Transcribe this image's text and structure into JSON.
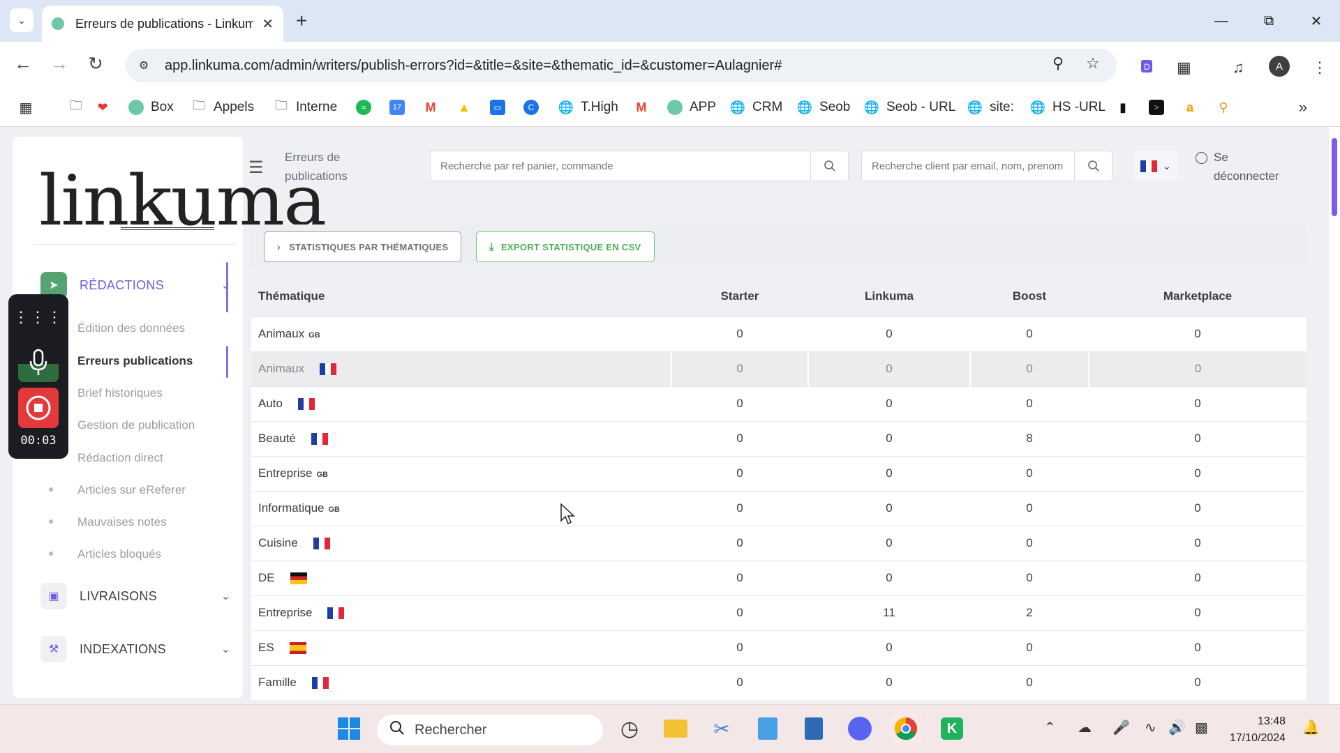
{
  "browser": {
    "tab_title": "Erreurs de publications - Linkuma",
    "url": "app.linkuma.com/admin/writers/publish-errors?id=&title=&site=&thematic_id=&customer=Aulagnier#",
    "profile_initial": "A",
    "bookmarks": [
      {
        "label": "Box",
        "icon": "linkuma-favicon"
      },
      {
        "label": "Appels",
        "icon": "folder-icon"
      },
      {
        "label": "Interne",
        "icon": "folder-icon"
      },
      {
        "label": "T.High",
        "icon": "globe-icon"
      },
      {
        "label": "APP",
        "icon": "linkuma-favicon"
      },
      {
        "label": "CRM",
        "icon": "globe-icon"
      },
      {
        "label": "Seob",
        "icon": "globe-icon"
      },
      {
        "label": "Seob - URL",
        "icon": "globe-icon"
      },
      {
        "label": "site:",
        "icon": "globe-icon"
      },
      {
        "label": "HS -URL",
        "icon": "globe-icon"
      }
    ]
  },
  "sidebar": {
    "logo_text": "linkuma",
    "sections": [
      {
        "label": "RÉDACTIONS",
        "color": "#57a272"
      },
      {
        "label": "LIVRAISONS"
      },
      {
        "label": "INDEXATIONS"
      }
    ],
    "links": [
      "Édition des données",
      "Erreurs publications",
      "Brief historiques",
      "Gestion de publication",
      "Rédaction direct",
      "Articles sur eReferer",
      "Mauvaises notes",
      "Articles bloqués"
    ]
  },
  "recorder": {
    "time": "00:03"
  },
  "header": {
    "title": "Erreurs de publications",
    "search_order_placeholder": "Recherche par ref panier, commande",
    "search_client_placeholder": "Recherche client par email, nom, prenom",
    "logout_label": "Se déconnecter"
  },
  "actions": {
    "stats_label": "STATISTIQUES PAR THÉMATIQUES",
    "export_label": "EXPORT STATISTIQUE EN CSV"
  },
  "table": {
    "columns": [
      "Thématique",
      "Starter",
      "Linkuma",
      "Boost",
      "Marketplace"
    ],
    "rows": [
      {
        "name": "Animaux",
        "lang": "GB",
        "values": [
          "0",
          "0",
          "0",
          "0"
        ]
      },
      {
        "name": "Animaux",
        "lang": "FR",
        "values": [
          "0",
          "0",
          "0",
          "0"
        ]
      },
      {
        "name": "Auto",
        "lang": "FR",
        "values": [
          "0",
          "0",
          "0",
          "0"
        ]
      },
      {
        "name": "Beauté",
        "lang": "FR",
        "values": [
          "0",
          "0",
          "8",
          "0"
        ]
      },
      {
        "name": "Entreprise",
        "lang": "GB",
        "values": [
          "0",
          "0",
          "0",
          "0"
        ]
      },
      {
        "name": "Informatique",
        "lang": "GB",
        "values": [
          "0",
          "0",
          "0",
          "0"
        ]
      },
      {
        "name": "Cuisine",
        "lang": "FR",
        "values": [
          "0",
          "0",
          "0",
          "0"
        ]
      },
      {
        "name": "DE",
        "lang": "DE",
        "values": [
          "0",
          "0",
          "0",
          "0"
        ]
      },
      {
        "name": "Entreprise",
        "lang": "FR",
        "values": [
          "0",
          "11",
          "2",
          "0"
        ]
      },
      {
        "name": "ES",
        "lang": "ES",
        "values": [
          "0",
          "0",
          "0",
          "0"
        ]
      },
      {
        "name": "Famille",
        "lang": "FR",
        "values": [
          "0",
          "0",
          "0",
          "0"
        ]
      }
    ]
  },
  "taskbar": {
    "search_label": "Rechercher",
    "time": "13:48",
    "date": "17/10/2024"
  }
}
